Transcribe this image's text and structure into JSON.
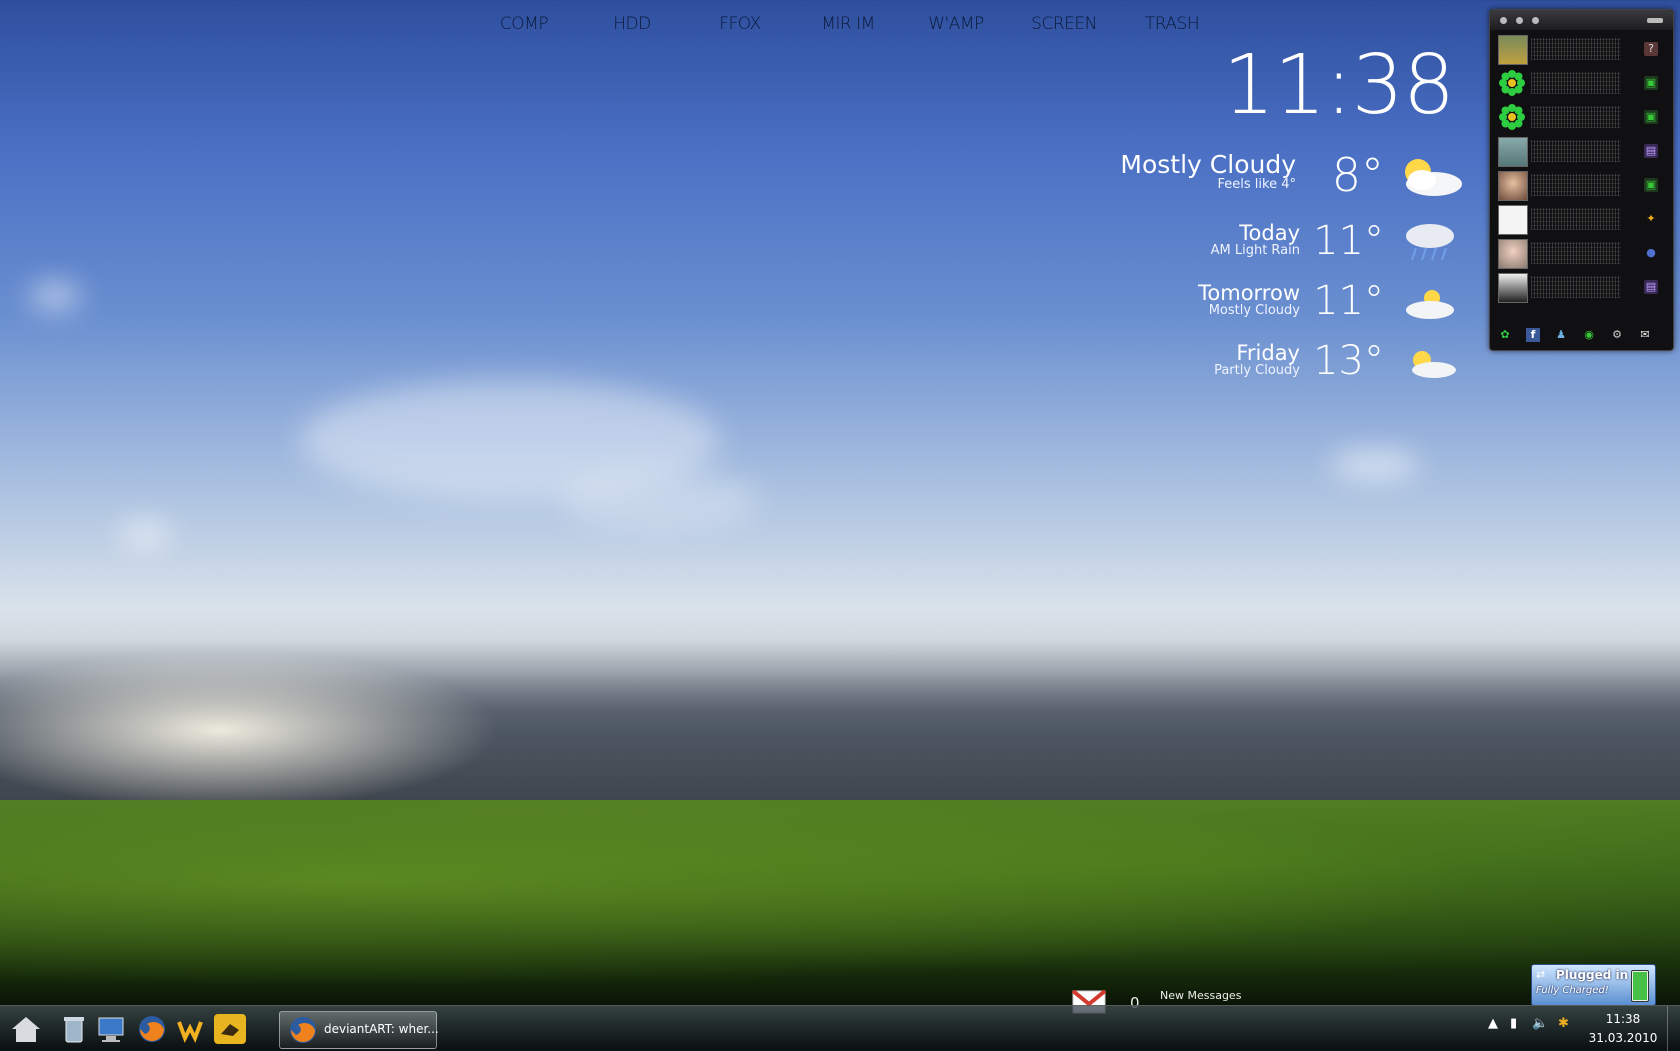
{
  "topnav": {
    "items": [
      "COMP",
      "HDD",
      "FFOX",
      "MIR IM",
      "W'AMP",
      "SCREEN",
      "TRASH"
    ]
  },
  "clock": {
    "time": "11:38"
  },
  "weather": {
    "current": {
      "condition": "Mostly Cloudy",
      "feels_like": "Feels like 4°",
      "temp": "8°",
      "icon": "partly-cloudy-icon"
    },
    "forecast": [
      {
        "day": "Today",
        "condition": "AM Light Rain",
        "temp": "11°",
        "icon": "rain-cloud-icon"
      },
      {
        "day": "Tomorrow",
        "condition": "Mostly Cloudy",
        "temp": "11°",
        "icon": "cloud-sun-icon"
      },
      {
        "day": "Friday",
        "condition": "Partly Cloudy",
        "temp": "13°",
        "icon": "sun-cloud-icon"
      }
    ]
  },
  "messenger": {
    "contacts": [
      {
        "avatar": "car-avatar",
        "status": "unknown",
        "status_color": "#8a6060"
      },
      {
        "avatar": "icq-flower",
        "status": "online",
        "status_color": "#38c838"
      },
      {
        "avatar": "icq-flower",
        "status": "online",
        "status_color": "#38c838"
      },
      {
        "avatar": "no-photo",
        "status": "away",
        "status_color": "#7a4ac8"
      },
      {
        "avatar": "face-photo",
        "status": "online",
        "status_color": "#38c838"
      },
      {
        "avatar": "puma-logo",
        "status": "aim",
        "status_color": "#f0b020"
      },
      {
        "avatar": "girl-photo",
        "status": "multi",
        "status_color": "#5070d0"
      },
      {
        "avatar": "bw-photo",
        "status": "away",
        "status_color": "#7a4ac8"
      }
    ],
    "footer_icons": [
      "icq-icon",
      "facebook-icon",
      "contact-icon",
      "chat-icon",
      "settings-icon",
      "message-icon"
    ]
  },
  "gmail": {
    "count": "0",
    "label": "New Messages"
  },
  "battery": {
    "title": "Plugged in",
    "subtitle": "Fully Charged!",
    "charge_percent": 100
  },
  "taskbar": {
    "quicklaunch": [
      "home-icon",
      "recycle-bin-icon",
      "computer-icon",
      "firefox-icon",
      "winamp-icon",
      "miranda-icon"
    ],
    "active_window": "deviantART: wher...",
    "time": "11:38",
    "date": "31.03.2010"
  },
  "colors": {
    "sky_top": "#2f4f9e",
    "grass": "#3b661a",
    "taskbar": "#1a2028"
  }
}
